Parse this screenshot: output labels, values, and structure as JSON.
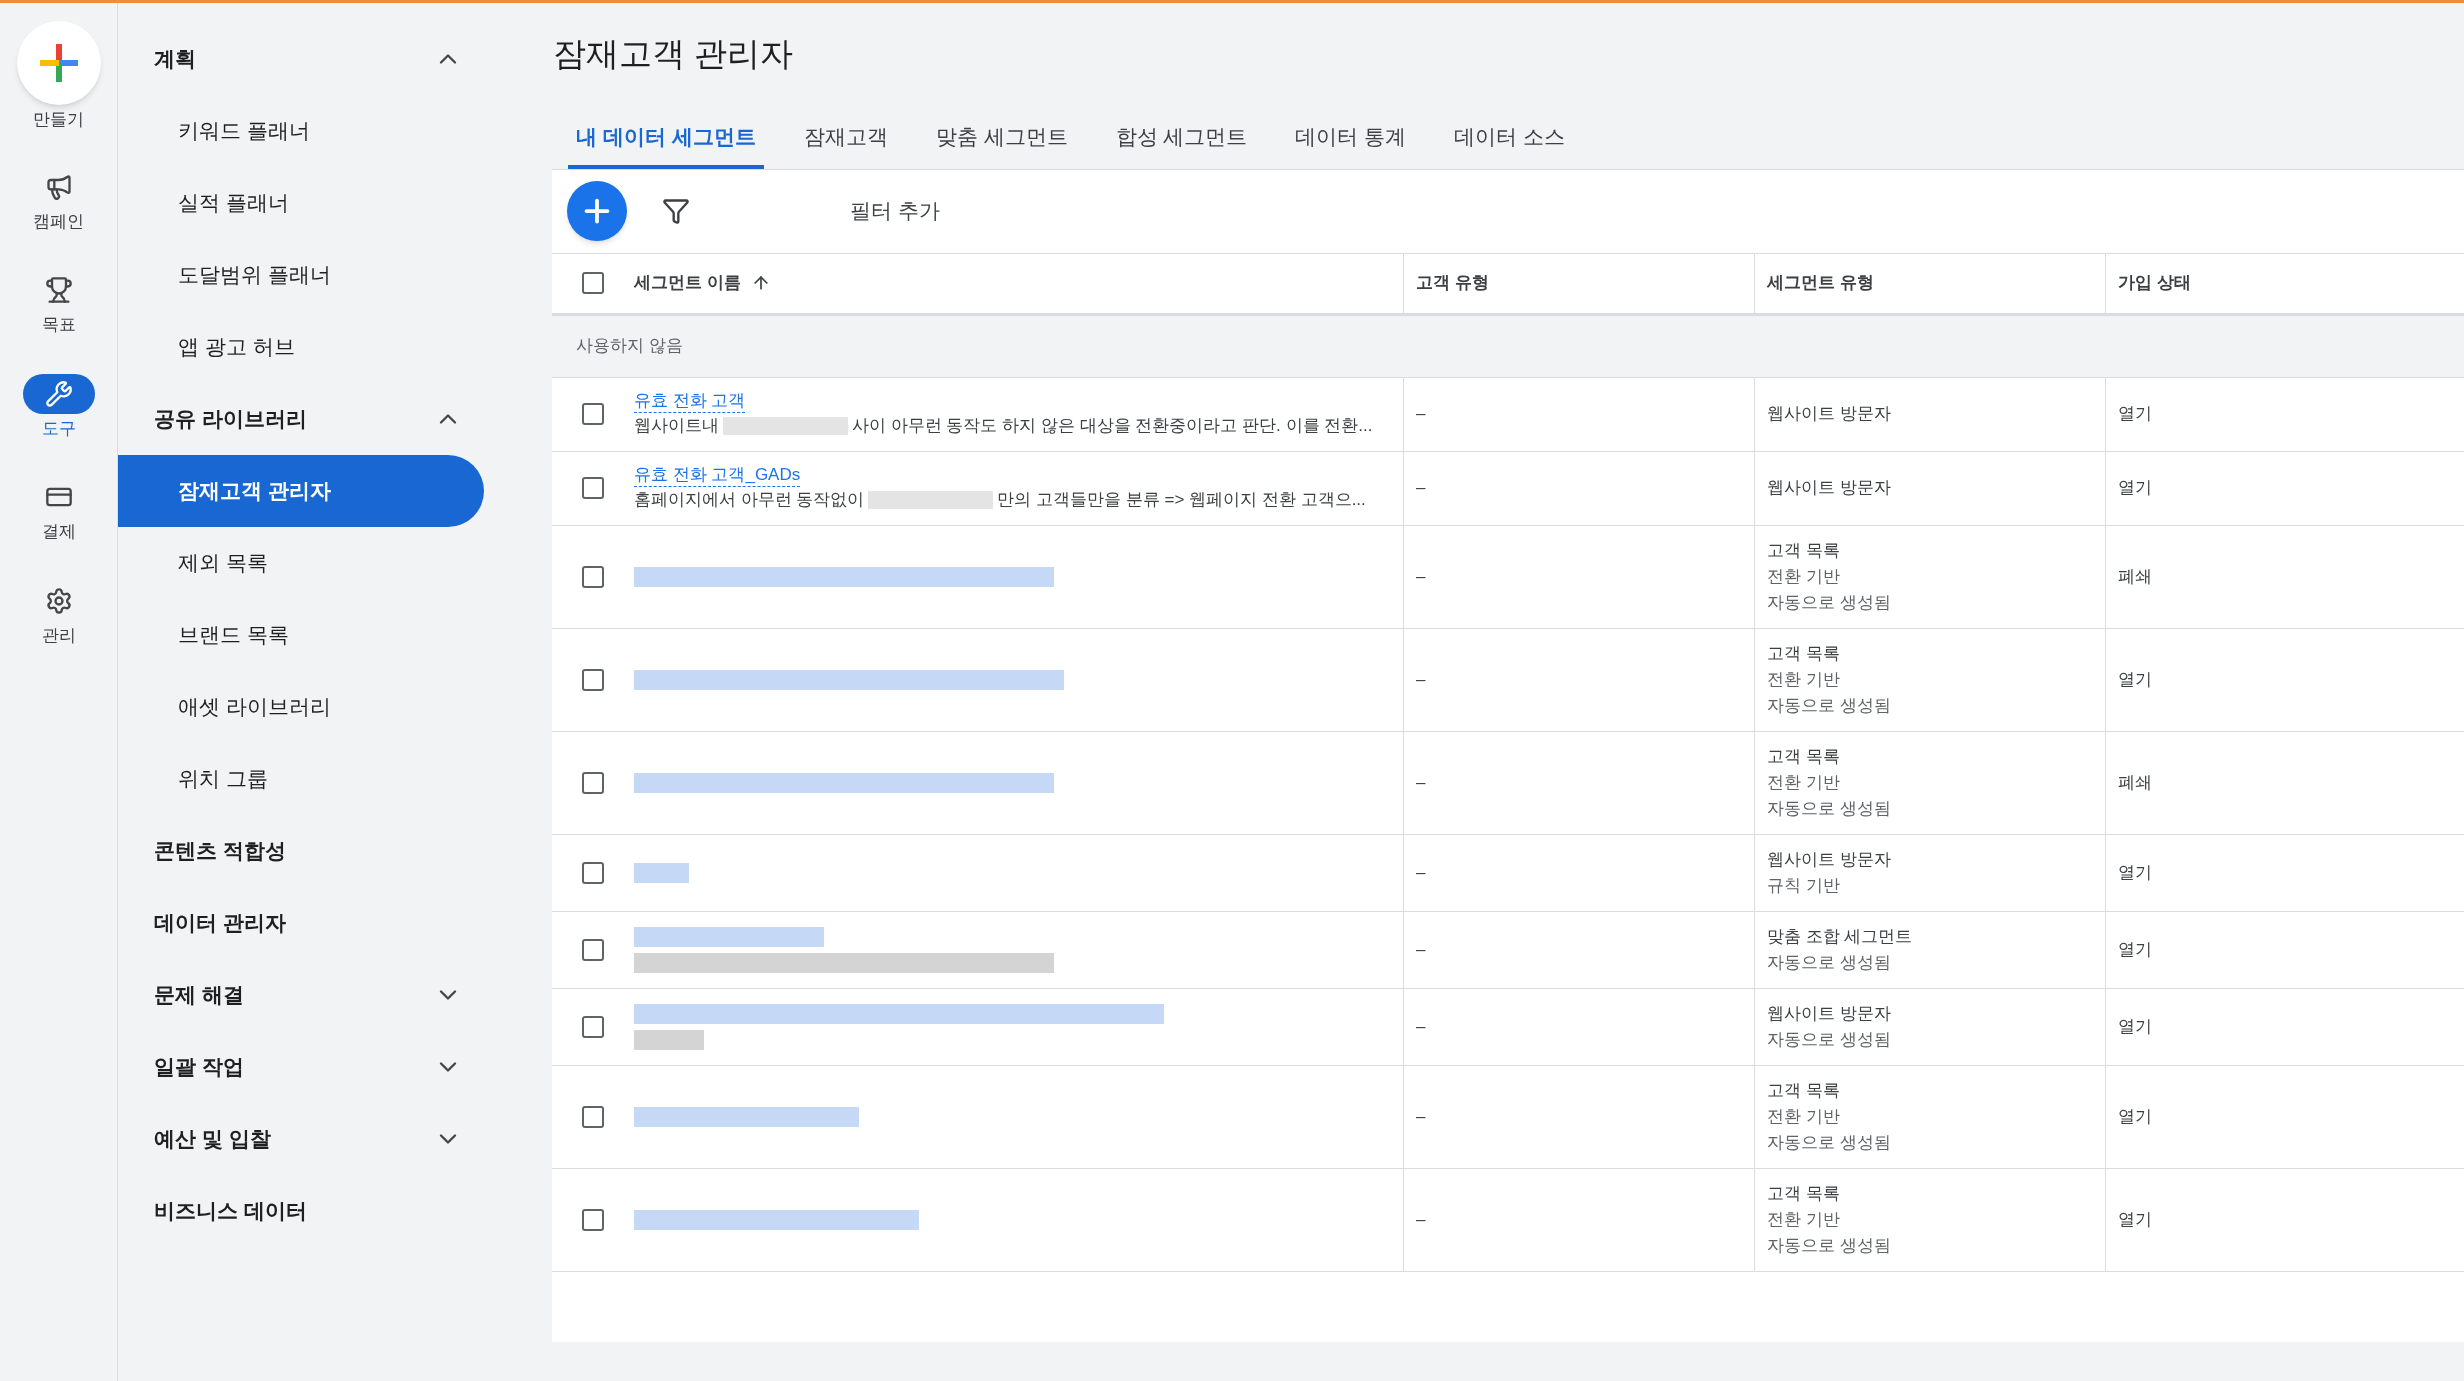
{
  "rail": [
    {
      "kind": "create",
      "label": "만들기",
      "selected": false
    },
    {
      "kind": "campaign",
      "label": "캠페인",
      "selected": false
    },
    {
      "kind": "goal",
      "label": "목표",
      "selected": false
    },
    {
      "kind": "tools",
      "label": "도구",
      "selected": true
    },
    {
      "kind": "billing",
      "label": "결제",
      "selected": false
    },
    {
      "kind": "admin",
      "label": "관리",
      "selected": false
    }
  ],
  "sidebar": [
    {
      "label": "계획",
      "expanded": true,
      "children": [
        {
          "label": "키워드 플래너",
          "selected": false
        },
        {
          "label": "실적 플래너",
          "selected": false
        },
        {
          "label": "도달범위 플래너",
          "selected": false
        },
        {
          "label": "앱 광고 허브",
          "selected": false
        }
      ]
    },
    {
      "label": "공유 라이브러리",
      "expanded": true,
      "children": [
        {
          "label": "잠재고객 관리자",
          "selected": true
        },
        {
          "label": "제외 목록",
          "selected": false
        },
        {
          "label": "브랜드 목록",
          "selected": false
        },
        {
          "label": "애셋 라이브러리",
          "selected": false
        },
        {
          "label": "위치 그룹",
          "selected": false
        }
      ]
    },
    {
      "label": "콘텐츠 적합성"
    },
    {
      "label": "데이터 관리자"
    },
    {
      "label": "문제 해결",
      "expanded": false
    },
    {
      "label": "일괄 작업",
      "expanded": false
    },
    {
      "label": "예산 및 입찰",
      "expanded": false
    },
    {
      "label": "비즈니스 데이터"
    }
  ],
  "page_title": "잠재고객 관리자",
  "tabs": [
    {
      "label": "내 데이터 세그먼트",
      "selected": true
    },
    {
      "label": "잠재고객",
      "selected": false
    },
    {
      "label": "맞춤 세그먼트",
      "selected": false
    },
    {
      "label": "합성 세그먼트",
      "selected": false
    },
    {
      "label": "데이터 통계",
      "selected": false
    },
    {
      "label": "데이터 소스",
      "selected": false
    }
  ],
  "toolbar": {
    "filter_label": "필터 추가"
  },
  "table": {
    "columns": [
      {
        "label": "세그먼트 이름",
        "sorted": true
      },
      {
        "label": "고객 유형"
      },
      {
        "label": "세그먼트 유형"
      },
      {
        "label": "가입 상태"
      }
    ],
    "select_all_checked": false,
    "group_label": "사용하지 않음",
    "rows": [
      {
        "kind": "text",
        "checked": false,
        "name": "유효 전화 고객",
        "description": [
          "웹사이트내",
          "사이 아무런 동작도 하지 않은 대상을 전환중이라고 판단. 이를 전환..."
        ],
        "customer_type": "–",
        "segment_type": [
          "웹사이트 방문자"
        ],
        "status": "열기"
      },
      {
        "kind": "text",
        "checked": false,
        "name": "유효 전화 고객_GADs",
        "description": [
          "홈페이지에서 아무런 동작없이",
          "만의 고객들만을 분류 => 웹페이지 전환 고객으..."
        ],
        "customer_type": "–",
        "segment_type": [
          "웹사이트 방문자"
        ],
        "status": "열기"
      },
      {
        "kind": "redacted",
        "checked": false,
        "customer_type": "–",
        "segment_type": [
          "고객 목록",
          "전환 기반",
          "자동으로 생성됨"
        ],
        "status": "폐쇄"
      },
      {
        "kind": "redacted",
        "checked": false,
        "customer_type": "–",
        "segment_type": [
          "고객 목록",
          "전환 기반",
          "자동으로 생성됨"
        ],
        "status": "열기"
      },
      {
        "kind": "redacted",
        "checked": false,
        "customer_type": "–",
        "segment_type": [
          "고객 목록",
          "전환 기반",
          "자동으로 생성됨"
        ],
        "status": "폐쇄"
      },
      {
        "kind": "redacted",
        "checked": false,
        "customer_type": "–",
        "segment_type": [
          "웹사이트 방문자",
          "규칙 기반"
        ],
        "status": "열기"
      },
      {
        "kind": "redacted_desc",
        "checked": false,
        "customer_type": "–",
        "segment_type": [
          "맞춤 조합 세그먼트",
          "자동으로 생성됨"
        ],
        "status": "열기"
      },
      {
        "kind": "redacted_desc",
        "checked": false,
        "customer_type": "–",
        "segment_type": [
          "웹사이트 방문자",
          "자동으로 생성됨"
        ],
        "status": "열기"
      },
      {
        "kind": "redacted",
        "checked": false,
        "customer_type": "–",
        "segment_type": [
          "고객 목록",
          "전환 기반",
          "자동으로 생성됨"
        ],
        "status": "열기"
      },
      {
        "kind": "redacted",
        "checked": false,
        "customer_type": "–",
        "segment_type": [
          "고객 목록",
          "전환 기반",
          "자동으로 생성됨"
        ],
        "status": "열기"
      }
    ]
  }
}
